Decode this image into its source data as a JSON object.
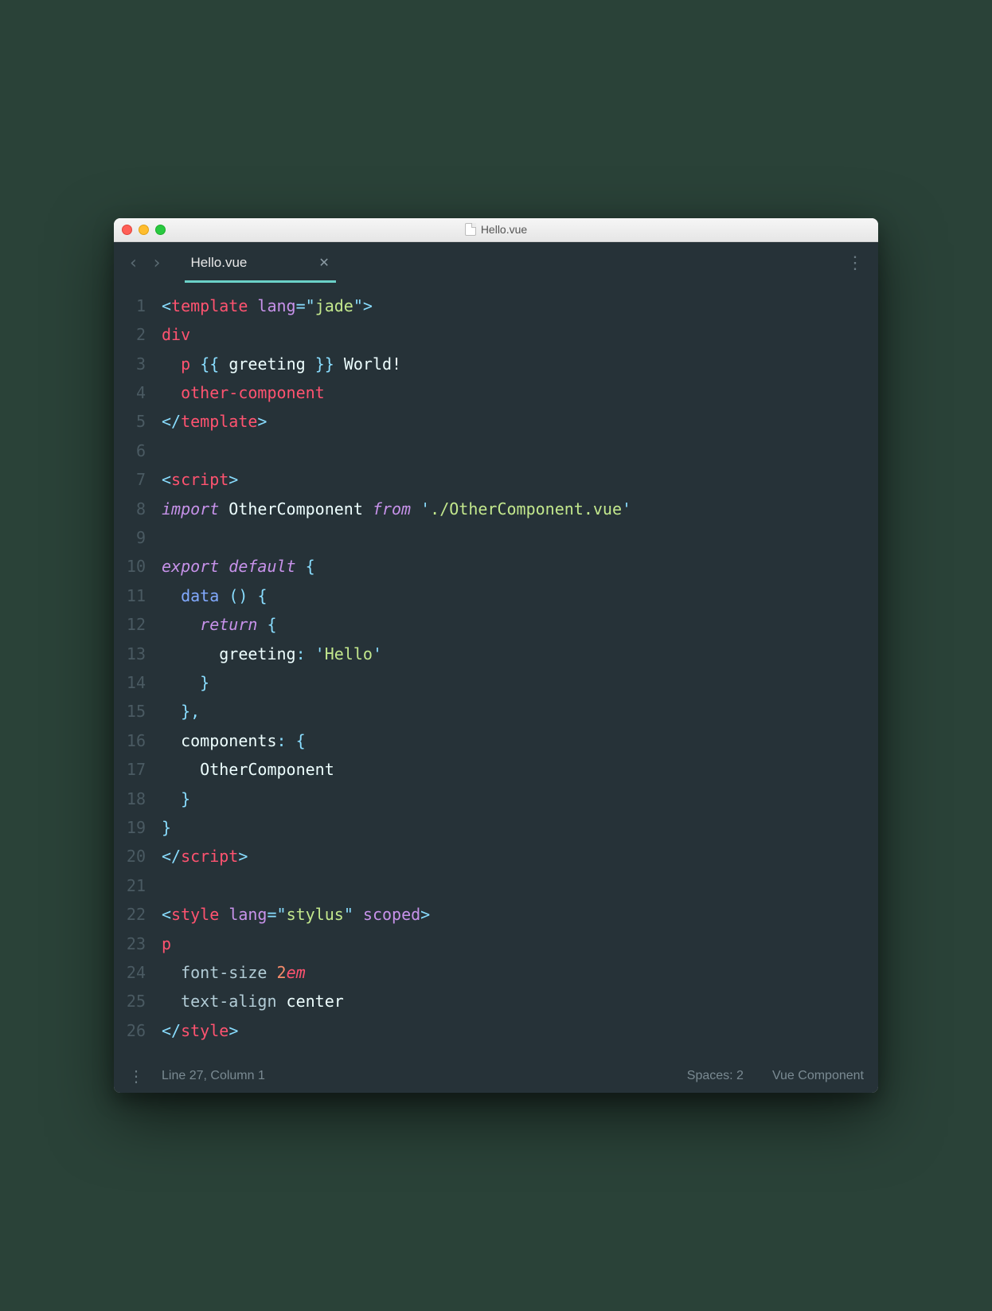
{
  "window": {
    "title": "Hello.vue"
  },
  "tab": {
    "name": "Hello.vue"
  },
  "status": {
    "position": "Line 27, Column 1",
    "spaces": "Spaces: 2",
    "syntax": "Vue Component"
  },
  "code": {
    "lines": [
      {
        "n": "1",
        "tokens": [
          [
            "c-pun",
            "<"
          ],
          [
            "c-tag",
            "template"
          ],
          [
            "c-txt",
            " "
          ],
          [
            "c-attr",
            "lang"
          ],
          [
            "c-pun",
            "="
          ],
          [
            "c-pun",
            "\""
          ],
          [
            "c-str",
            "jade"
          ],
          [
            "c-pun",
            "\""
          ],
          [
            "c-pun",
            ">"
          ]
        ]
      },
      {
        "n": "2",
        "tokens": [
          [
            "c-tag",
            "div"
          ]
        ]
      },
      {
        "n": "3",
        "tokens": [
          [
            "c-txt",
            "  "
          ],
          [
            "c-tag",
            "p"
          ],
          [
            "c-txt",
            " "
          ],
          [
            "c-pun",
            "{{"
          ],
          [
            "c-txt",
            " greeting "
          ],
          [
            "c-pun",
            "}}"
          ],
          [
            "c-txt",
            " World!"
          ]
        ]
      },
      {
        "n": "4",
        "tokens": [
          [
            "c-txt",
            "  "
          ],
          [
            "c-tag",
            "other-component"
          ]
        ]
      },
      {
        "n": "5",
        "tokens": [
          [
            "c-pun",
            "</"
          ],
          [
            "c-tag",
            "template"
          ],
          [
            "c-pun",
            ">"
          ]
        ]
      },
      {
        "n": "6",
        "tokens": [
          [
            "c-txt",
            ""
          ]
        ]
      },
      {
        "n": "7",
        "tokens": [
          [
            "c-pun",
            "<"
          ],
          [
            "c-tag",
            "script"
          ],
          [
            "c-pun",
            ">"
          ]
        ]
      },
      {
        "n": "8",
        "tokens": [
          [
            "c-kw",
            "import"
          ],
          [
            "c-txt",
            " OtherComponent "
          ],
          [
            "c-kw",
            "from"
          ],
          [
            "c-txt",
            " "
          ],
          [
            "c-pun",
            "'"
          ],
          [
            "c-str",
            "./OtherComponent.vue"
          ],
          [
            "c-pun",
            "'"
          ]
        ]
      },
      {
        "n": "9",
        "tokens": [
          [
            "c-txt",
            ""
          ]
        ]
      },
      {
        "n": "10",
        "tokens": [
          [
            "c-kw",
            "export"
          ],
          [
            "c-txt",
            " "
          ],
          [
            "c-kw",
            "default"
          ],
          [
            "c-txt",
            " "
          ],
          [
            "c-pun",
            "{"
          ]
        ]
      },
      {
        "n": "11",
        "tokens": [
          [
            "c-txt",
            "  "
          ],
          [
            "c-fn",
            "data"
          ],
          [
            "c-txt",
            " "
          ],
          [
            "c-pun",
            "()"
          ],
          [
            "c-txt",
            " "
          ],
          [
            "c-pun",
            "{"
          ]
        ]
      },
      {
        "n": "12",
        "tokens": [
          [
            "c-txt",
            "    "
          ],
          [
            "c-kw",
            "return"
          ],
          [
            "c-txt",
            " "
          ],
          [
            "c-pun",
            "{"
          ]
        ]
      },
      {
        "n": "13",
        "tokens": [
          [
            "c-txt",
            "      greeting"
          ],
          [
            "c-pun",
            ":"
          ],
          [
            "c-txt",
            " "
          ],
          [
            "c-pun",
            "'"
          ],
          [
            "c-str",
            "Hello"
          ],
          [
            "c-pun",
            "'"
          ]
        ]
      },
      {
        "n": "14",
        "tokens": [
          [
            "c-txt",
            "    "
          ],
          [
            "c-pun",
            "}"
          ]
        ]
      },
      {
        "n": "15",
        "tokens": [
          [
            "c-txt",
            "  "
          ],
          [
            "c-pun",
            "},"
          ]
        ]
      },
      {
        "n": "16",
        "tokens": [
          [
            "c-txt",
            "  components"
          ],
          [
            "c-pun",
            ":"
          ],
          [
            "c-txt",
            " "
          ],
          [
            "c-pun",
            "{"
          ]
        ]
      },
      {
        "n": "17",
        "tokens": [
          [
            "c-txt",
            "    OtherComponent"
          ]
        ]
      },
      {
        "n": "18",
        "tokens": [
          [
            "c-txt",
            "  "
          ],
          [
            "c-pun",
            "}"
          ]
        ]
      },
      {
        "n": "19",
        "tokens": [
          [
            "c-pun",
            "}"
          ]
        ]
      },
      {
        "n": "20",
        "tokens": [
          [
            "c-pun",
            "</"
          ],
          [
            "c-tag",
            "script"
          ],
          [
            "c-pun",
            ">"
          ]
        ]
      },
      {
        "n": "21",
        "tokens": [
          [
            "c-txt",
            ""
          ]
        ]
      },
      {
        "n": "22",
        "tokens": [
          [
            "c-pun",
            "<"
          ],
          [
            "c-tag",
            "style"
          ],
          [
            "c-txt",
            " "
          ],
          [
            "c-attr",
            "lang"
          ],
          [
            "c-pun",
            "="
          ],
          [
            "c-pun",
            "\""
          ],
          [
            "c-str",
            "stylus"
          ],
          [
            "c-pun",
            "\""
          ],
          [
            "c-txt",
            " "
          ],
          [
            "c-attr",
            "scoped"
          ],
          [
            "c-pun",
            ">"
          ]
        ]
      },
      {
        "n": "23",
        "tokens": [
          [
            "c-tag",
            "p"
          ]
        ]
      },
      {
        "n": "24",
        "tokens": [
          [
            "c-txt",
            "  "
          ],
          [
            "c-prop",
            "font-size"
          ],
          [
            "c-txt",
            " "
          ],
          [
            "c-num",
            "2"
          ],
          [
            "c-unit",
            "em"
          ]
        ]
      },
      {
        "n": "25",
        "tokens": [
          [
            "c-txt",
            "  "
          ],
          [
            "c-prop",
            "text-align"
          ],
          [
            "c-txt",
            " center"
          ]
        ]
      },
      {
        "n": "26",
        "tokens": [
          [
            "c-pun",
            "</"
          ],
          [
            "c-tag",
            "style"
          ],
          [
            "c-pun",
            ">"
          ]
        ]
      }
    ]
  }
}
